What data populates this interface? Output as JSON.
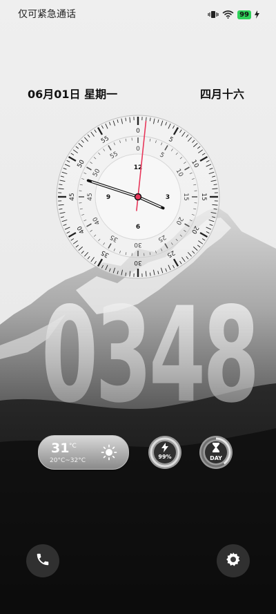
{
  "status_bar": {
    "carrier_text": "仅可紧急通话",
    "battery_level": "99",
    "icons": [
      "vibrate-icon",
      "wifi-icon",
      "battery-icon",
      "charging-icon"
    ]
  },
  "date": {
    "gregorian": "06月01日 星期一",
    "lunar": "四月十六"
  },
  "analog_clock": {
    "hour_numbers": [
      "12",
      "3",
      "6",
      "9"
    ],
    "second_numbers": [
      "0",
      "5",
      "10",
      "15",
      "20",
      "25",
      "30",
      "35",
      "40",
      "45",
      "50",
      "55"
    ],
    "time": {
      "hours": 3,
      "minutes": 48,
      "seconds": 1
    }
  },
  "digital_clock": {
    "hours": "03",
    "minutes": "48"
  },
  "weather": {
    "temp": "31",
    "unit": "°C",
    "range": "20°C~32°C",
    "icon": "sun-icon"
  },
  "battery_widget": {
    "label": "99%",
    "level": 0.99,
    "icon": "lightning-icon"
  },
  "day_widget": {
    "label": "DAY",
    "icon": "hourglass-icon",
    "level": 0.4
  },
  "shortcuts": {
    "left": "phone-icon",
    "right": "camera-settings-icon"
  },
  "colors": {
    "second_hand": "#e8365a",
    "battery_green": "#2fd15a"
  }
}
